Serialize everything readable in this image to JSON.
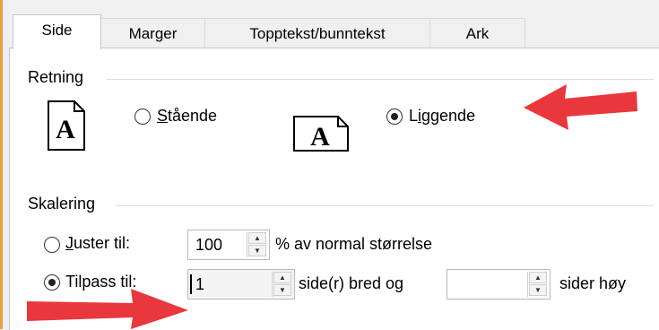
{
  "tabs": [
    {
      "label": "Side",
      "active": true
    },
    {
      "label": "Marger"
    },
    {
      "label": "Topptekst/bunntekst"
    },
    {
      "label": "Ark"
    }
  ],
  "orientation": {
    "group_label": "Retning",
    "portrait_label": "Stående",
    "portrait_underline": "S",
    "landscape_label": "Liggende",
    "landscape_underline": "i",
    "selected": "landscape",
    "icon_letter": "A"
  },
  "scaling": {
    "group_label": "Skalering",
    "adjust_label": "Juster til:",
    "adjust_value": "100",
    "adjust_suffix": "% av normal størrelse",
    "fit_label": "Tilpass til:",
    "fit_wide_value": "1",
    "fit_wide_suffix": "side(r) bred og",
    "fit_tall_value": "",
    "fit_tall_suffix": "sider høy",
    "selected": "fit"
  },
  "colors": {
    "arrow": "#e8383d",
    "frame_accent": "#e8a33d"
  }
}
